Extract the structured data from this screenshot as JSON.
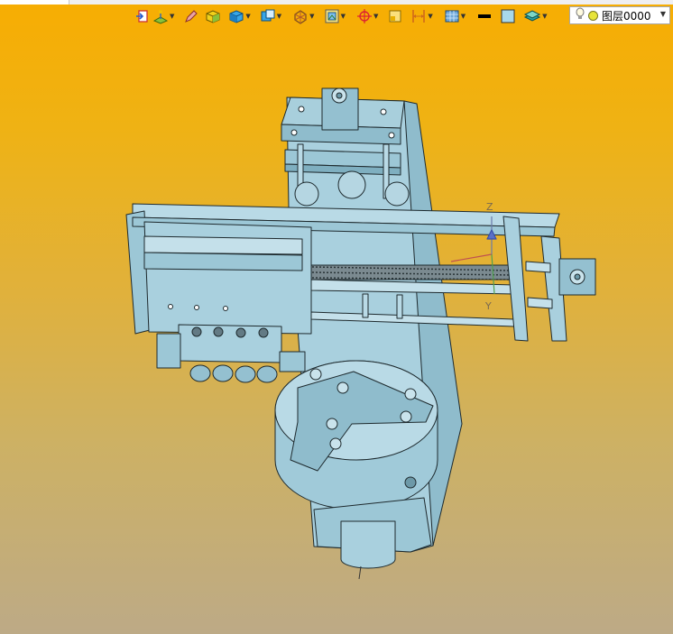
{
  "toolbar": {
    "layer_selector": {
      "value": "图层0000"
    }
  },
  "colors": {
    "background_top": "#f7ad02",
    "background_bottom": "#bdaa86",
    "part_fill": "#a8d0de",
    "part_edge": "#1e2a2e"
  },
  "icons": [
    "exit-sketch-icon",
    "sketch-plane-icon",
    "pen-icon",
    "box-icon",
    "cube-view-icon",
    "shaded-view-icon",
    "orientation-icon",
    "frame-view-icon",
    "origin-icon",
    "rectangle-icon",
    "dimension-icon",
    "render-mode-icon",
    "line-color-icon",
    "fill-color-icon",
    "layer-stack-icon",
    "bulb-icon",
    "layer-color-icon"
  ]
}
